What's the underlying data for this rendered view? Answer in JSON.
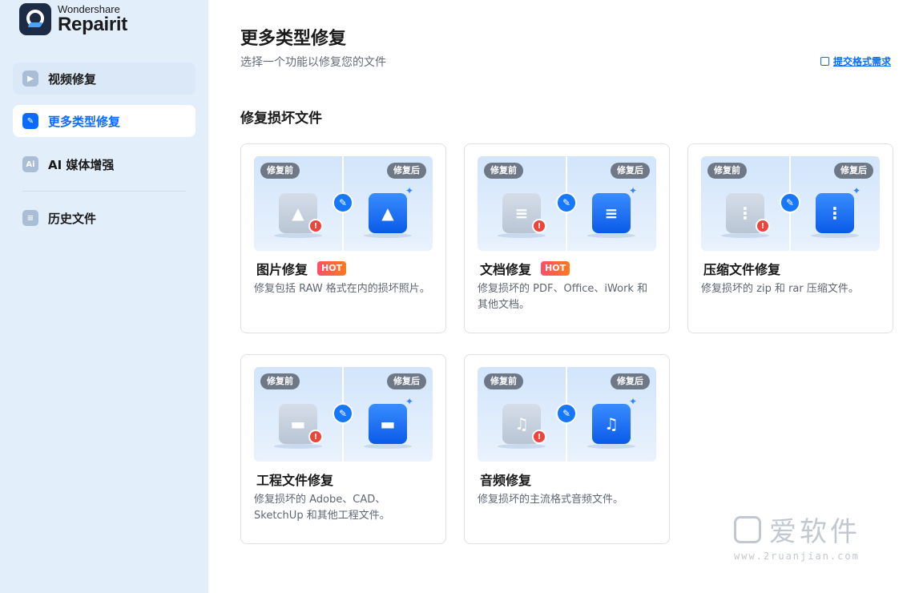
{
  "app": {
    "brand_line1": "Wondershare",
    "brand_line2": "Repairit"
  },
  "sidebar": {
    "items": [
      {
        "label": "视频修复",
        "icon": "play-icon"
      },
      {
        "label": "更多类型修复",
        "icon": "wrench-icon",
        "active": true
      },
      {
        "label": "AI 媒体增强",
        "icon": "ai-icon",
        "icon_text": "Ai"
      },
      {
        "label": "历史文件",
        "icon": "list-icon"
      }
    ]
  },
  "main": {
    "title": "更多类型修复",
    "subtitle": "选择一个功能以修复您的文件",
    "submit_link": "提交格式需求",
    "section_title": "修复损坏文件",
    "before_label": "修复前",
    "after_label": "修复后",
    "hot_label": "HOT",
    "cards": [
      {
        "title": "图片修复",
        "hot": true,
        "desc": "修复包括 RAW 格式在内的损坏照片。",
        "icon": "image-icon"
      },
      {
        "title": "文档修复",
        "hot": true,
        "desc": "修复损坏的 PDF、Office、iWork 和其他文档。",
        "icon": "document-icon"
      },
      {
        "title": "压缩文件修复",
        "hot": false,
        "desc": "修复损坏的 zip 和 rar 压缩文件。",
        "icon": "zip-icon"
      },
      {
        "title": "工程文件修复",
        "hot": false,
        "desc": "修复损坏的 Adobe、CAD、SketchUp 和其他工程文件。",
        "icon": "folder-icon"
      },
      {
        "title": "音频修复",
        "hot": false,
        "desc": "修复损坏的主流格式音频文件。",
        "icon": "music-icon"
      }
    ]
  },
  "watermark": {
    "main": "爱软件",
    "sub": "www.2ruanjian.com"
  },
  "colors": {
    "accent": "#0a6cff",
    "sidebar_bg": "#e3eefb",
    "hot_start": "#ff4d6a",
    "hot_end": "#ff7a1a",
    "warning": "#f0443a"
  }
}
